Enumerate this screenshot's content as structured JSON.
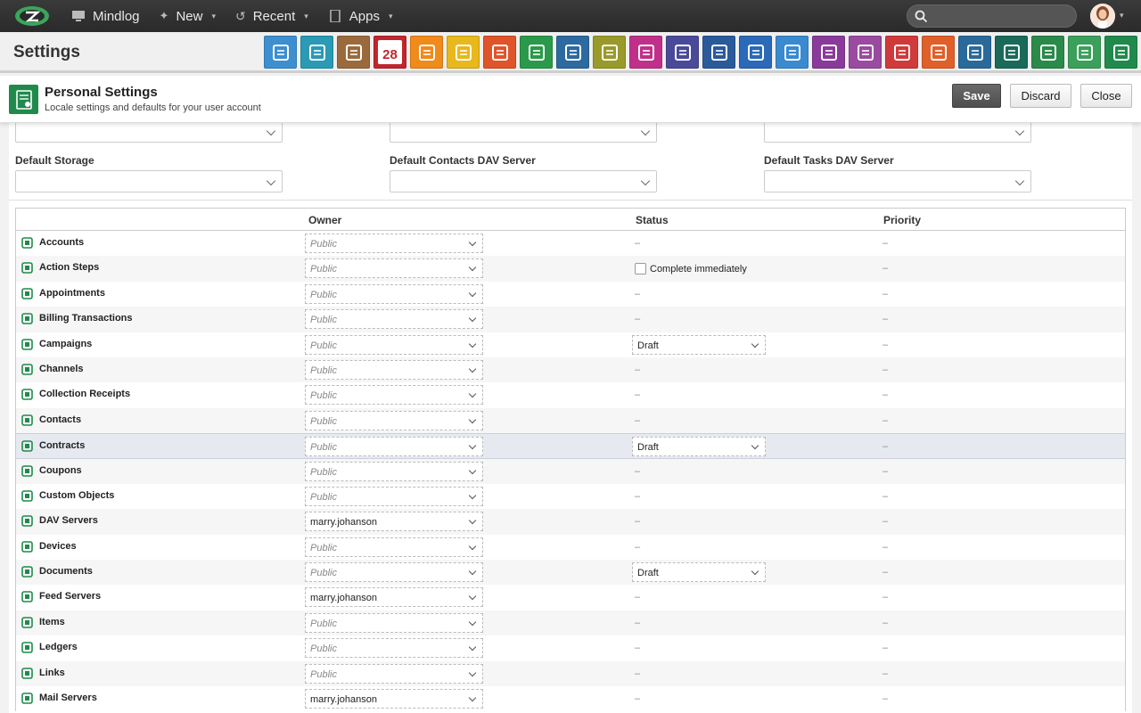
{
  "topbar": {
    "app_name": "Mindlog",
    "new_label": "New",
    "recent_label": "Recent",
    "apps_label": "Apps"
  },
  "header": {
    "title": "Settings"
  },
  "app_icons": [
    {
      "name": "mail-icon",
      "color": "#3d8fd0"
    },
    {
      "name": "email-address-icon",
      "color": "#2a9ab5"
    },
    {
      "name": "contacts-book-icon",
      "color": "#9b6a3c"
    },
    {
      "name": "calendar-icon",
      "color": "#c0262e",
      "text": "28"
    },
    {
      "name": "stopwatch-icon",
      "color": "#f08a1a"
    },
    {
      "name": "tasks-icon",
      "color": "#e8b81c"
    },
    {
      "name": "checklist-folder-icon",
      "color": "#e0542a"
    },
    {
      "name": "notes-icon",
      "color": "#2a9a4a"
    },
    {
      "name": "bookmark-icon",
      "color": "#2c6aa0"
    },
    {
      "name": "document-icon",
      "color": "#9a9a2a"
    },
    {
      "name": "cashier-icon",
      "color": "#c0308a"
    },
    {
      "name": "dollar-icon",
      "color": "#4a4a9a"
    },
    {
      "name": "truck-icon",
      "color": "#2a5a9a"
    },
    {
      "name": "recycle-icon",
      "color": "#2a6ab8"
    },
    {
      "name": "money-bag-icon",
      "color": "#3a8ad0"
    },
    {
      "name": "contract-icon",
      "color": "#8a3a9a"
    },
    {
      "name": "handshake-icon",
      "color": "#9a4aa0"
    },
    {
      "name": "invoice-icon",
      "color": "#d03a3a"
    },
    {
      "name": "broadcast-icon",
      "color": "#e0602a"
    },
    {
      "name": "download-icon",
      "color": "#2a6a9a"
    },
    {
      "name": "hand-truck-icon",
      "color": "#1a6a5a"
    },
    {
      "name": "cash-stack-icon",
      "color": "#2a8a4a"
    },
    {
      "name": "price-tag-icon",
      "color": "#3aa05a"
    },
    {
      "name": "database-icon",
      "color": "#1f8a4c"
    }
  ],
  "panel": {
    "title": "Personal Settings",
    "subtitle": "Locale settings and defaults for your user account",
    "save_label": "Save",
    "discard_label": "Discard",
    "close_label": "Close"
  },
  "fields": {
    "default_storage": "Default Storage",
    "default_contacts_dav": "Default Contacts DAV Server",
    "default_tasks_dav": "Default Tasks DAV Server"
  },
  "table": {
    "col_owner": "Owner",
    "col_status": "Status",
    "col_priority": "Priority",
    "dash": "–",
    "complete_immediately": "Complete immediately",
    "rows": [
      {
        "name": "Accounts",
        "owner": "Public",
        "status": "dash"
      },
      {
        "name": "Action Steps",
        "owner": "Public",
        "status": "check"
      },
      {
        "name": "Appointments",
        "owner": "Public",
        "status": "dash"
      },
      {
        "name": "Billing Transactions",
        "owner": "Public",
        "status": "dash"
      },
      {
        "name": "Campaigns",
        "owner": "Public",
        "status": "Draft"
      },
      {
        "name": "Channels",
        "owner": "Public",
        "status": "dash"
      },
      {
        "name": "Collection Receipts",
        "owner": "Public",
        "status": "dash"
      },
      {
        "name": "Contacts",
        "owner": "Public",
        "status": "dash"
      },
      {
        "name": "Contracts",
        "owner": "Public",
        "status": "Draft",
        "highlight": true
      },
      {
        "name": "Coupons",
        "owner": "Public",
        "status": "dash"
      },
      {
        "name": "Custom Objects",
        "owner": "Public",
        "status": "dash"
      },
      {
        "name": "DAV Servers",
        "owner": "marry.johanson",
        "status": "dash"
      },
      {
        "name": "Devices",
        "owner": "Public",
        "status": "dash"
      },
      {
        "name": "Documents",
        "owner": "Public",
        "status": "Draft"
      },
      {
        "name": "Feed Servers",
        "owner": "marry.johanson",
        "status": "dash"
      },
      {
        "name": "Items",
        "owner": "Public",
        "status": "dash"
      },
      {
        "name": "Ledgers",
        "owner": "Public",
        "status": "dash"
      },
      {
        "name": "Links",
        "owner": "Public",
        "status": "dash"
      },
      {
        "name": "Mail Servers",
        "owner": "marry.johanson",
        "status": "dash"
      }
    ]
  }
}
